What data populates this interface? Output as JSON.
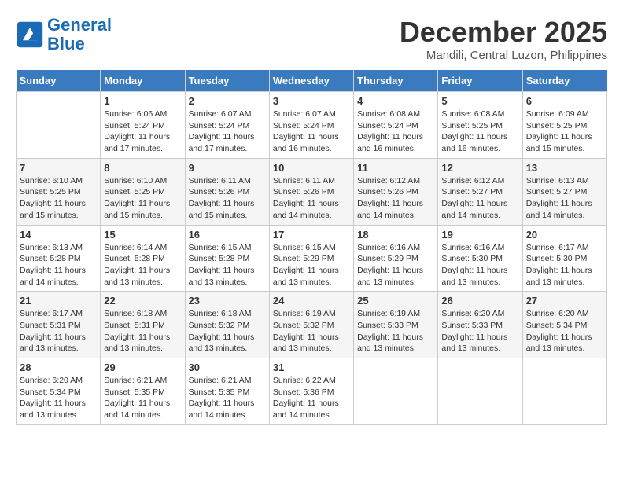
{
  "logo": {
    "line1": "General",
    "line2": "Blue"
  },
  "title": "December 2025",
  "location": "Mandili, Central Luzon, Philippines",
  "days_of_week": [
    "Sunday",
    "Monday",
    "Tuesday",
    "Wednesday",
    "Thursday",
    "Friday",
    "Saturday"
  ],
  "weeks": [
    [
      {
        "day": "",
        "info": ""
      },
      {
        "day": "1",
        "info": "Sunrise: 6:06 AM\nSunset: 5:24 PM\nDaylight: 11 hours\nand 17 minutes."
      },
      {
        "day": "2",
        "info": "Sunrise: 6:07 AM\nSunset: 5:24 PM\nDaylight: 11 hours\nand 17 minutes."
      },
      {
        "day": "3",
        "info": "Sunrise: 6:07 AM\nSunset: 5:24 PM\nDaylight: 11 hours\nand 16 minutes."
      },
      {
        "day": "4",
        "info": "Sunrise: 6:08 AM\nSunset: 5:24 PM\nDaylight: 11 hours\nand 16 minutes."
      },
      {
        "day": "5",
        "info": "Sunrise: 6:08 AM\nSunset: 5:25 PM\nDaylight: 11 hours\nand 16 minutes."
      },
      {
        "day": "6",
        "info": "Sunrise: 6:09 AM\nSunset: 5:25 PM\nDaylight: 11 hours\nand 15 minutes."
      }
    ],
    [
      {
        "day": "7",
        "info": "Sunrise: 6:10 AM\nSunset: 5:25 PM\nDaylight: 11 hours\nand 15 minutes."
      },
      {
        "day": "8",
        "info": "Sunrise: 6:10 AM\nSunset: 5:25 PM\nDaylight: 11 hours\nand 15 minutes."
      },
      {
        "day": "9",
        "info": "Sunrise: 6:11 AM\nSunset: 5:26 PM\nDaylight: 11 hours\nand 15 minutes."
      },
      {
        "day": "10",
        "info": "Sunrise: 6:11 AM\nSunset: 5:26 PM\nDaylight: 11 hours\nand 14 minutes."
      },
      {
        "day": "11",
        "info": "Sunrise: 6:12 AM\nSunset: 5:26 PM\nDaylight: 11 hours\nand 14 minutes."
      },
      {
        "day": "12",
        "info": "Sunrise: 6:12 AM\nSunset: 5:27 PM\nDaylight: 11 hours\nand 14 minutes."
      },
      {
        "day": "13",
        "info": "Sunrise: 6:13 AM\nSunset: 5:27 PM\nDaylight: 11 hours\nand 14 minutes."
      }
    ],
    [
      {
        "day": "14",
        "info": "Sunrise: 6:13 AM\nSunset: 5:28 PM\nDaylight: 11 hours\nand 14 minutes."
      },
      {
        "day": "15",
        "info": "Sunrise: 6:14 AM\nSunset: 5:28 PM\nDaylight: 11 hours\nand 13 minutes."
      },
      {
        "day": "16",
        "info": "Sunrise: 6:15 AM\nSunset: 5:28 PM\nDaylight: 11 hours\nand 13 minutes."
      },
      {
        "day": "17",
        "info": "Sunrise: 6:15 AM\nSunset: 5:29 PM\nDaylight: 11 hours\nand 13 minutes."
      },
      {
        "day": "18",
        "info": "Sunrise: 6:16 AM\nSunset: 5:29 PM\nDaylight: 11 hours\nand 13 minutes."
      },
      {
        "day": "19",
        "info": "Sunrise: 6:16 AM\nSunset: 5:30 PM\nDaylight: 11 hours\nand 13 minutes."
      },
      {
        "day": "20",
        "info": "Sunrise: 6:17 AM\nSunset: 5:30 PM\nDaylight: 11 hours\nand 13 minutes."
      }
    ],
    [
      {
        "day": "21",
        "info": "Sunrise: 6:17 AM\nSunset: 5:31 PM\nDaylight: 11 hours\nand 13 minutes."
      },
      {
        "day": "22",
        "info": "Sunrise: 6:18 AM\nSunset: 5:31 PM\nDaylight: 11 hours\nand 13 minutes."
      },
      {
        "day": "23",
        "info": "Sunrise: 6:18 AM\nSunset: 5:32 PM\nDaylight: 11 hours\nand 13 minutes."
      },
      {
        "day": "24",
        "info": "Sunrise: 6:19 AM\nSunset: 5:32 PM\nDaylight: 11 hours\nand 13 minutes."
      },
      {
        "day": "25",
        "info": "Sunrise: 6:19 AM\nSunset: 5:33 PM\nDaylight: 11 hours\nand 13 minutes."
      },
      {
        "day": "26",
        "info": "Sunrise: 6:20 AM\nSunset: 5:33 PM\nDaylight: 11 hours\nand 13 minutes."
      },
      {
        "day": "27",
        "info": "Sunrise: 6:20 AM\nSunset: 5:34 PM\nDaylight: 11 hours\nand 13 minutes."
      }
    ],
    [
      {
        "day": "28",
        "info": "Sunrise: 6:20 AM\nSunset: 5:34 PM\nDaylight: 11 hours\nand 13 minutes."
      },
      {
        "day": "29",
        "info": "Sunrise: 6:21 AM\nSunset: 5:35 PM\nDaylight: 11 hours\nand 14 minutes."
      },
      {
        "day": "30",
        "info": "Sunrise: 6:21 AM\nSunset: 5:35 PM\nDaylight: 11 hours\nand 14 minutes."
      },
      {
        "day": "31",
        "info": "Sunrise: 6:22 AM\nSunset: 5:36 PM\nDaylight: 11 hours\nand 14 minutes."
      },
      {
        "day": "",
        "info": ""
      },
      {
        "day": "",
        "info": ""
      },
      {
        "day": "",
        "info": ""
      }
    ]
  ]
}
